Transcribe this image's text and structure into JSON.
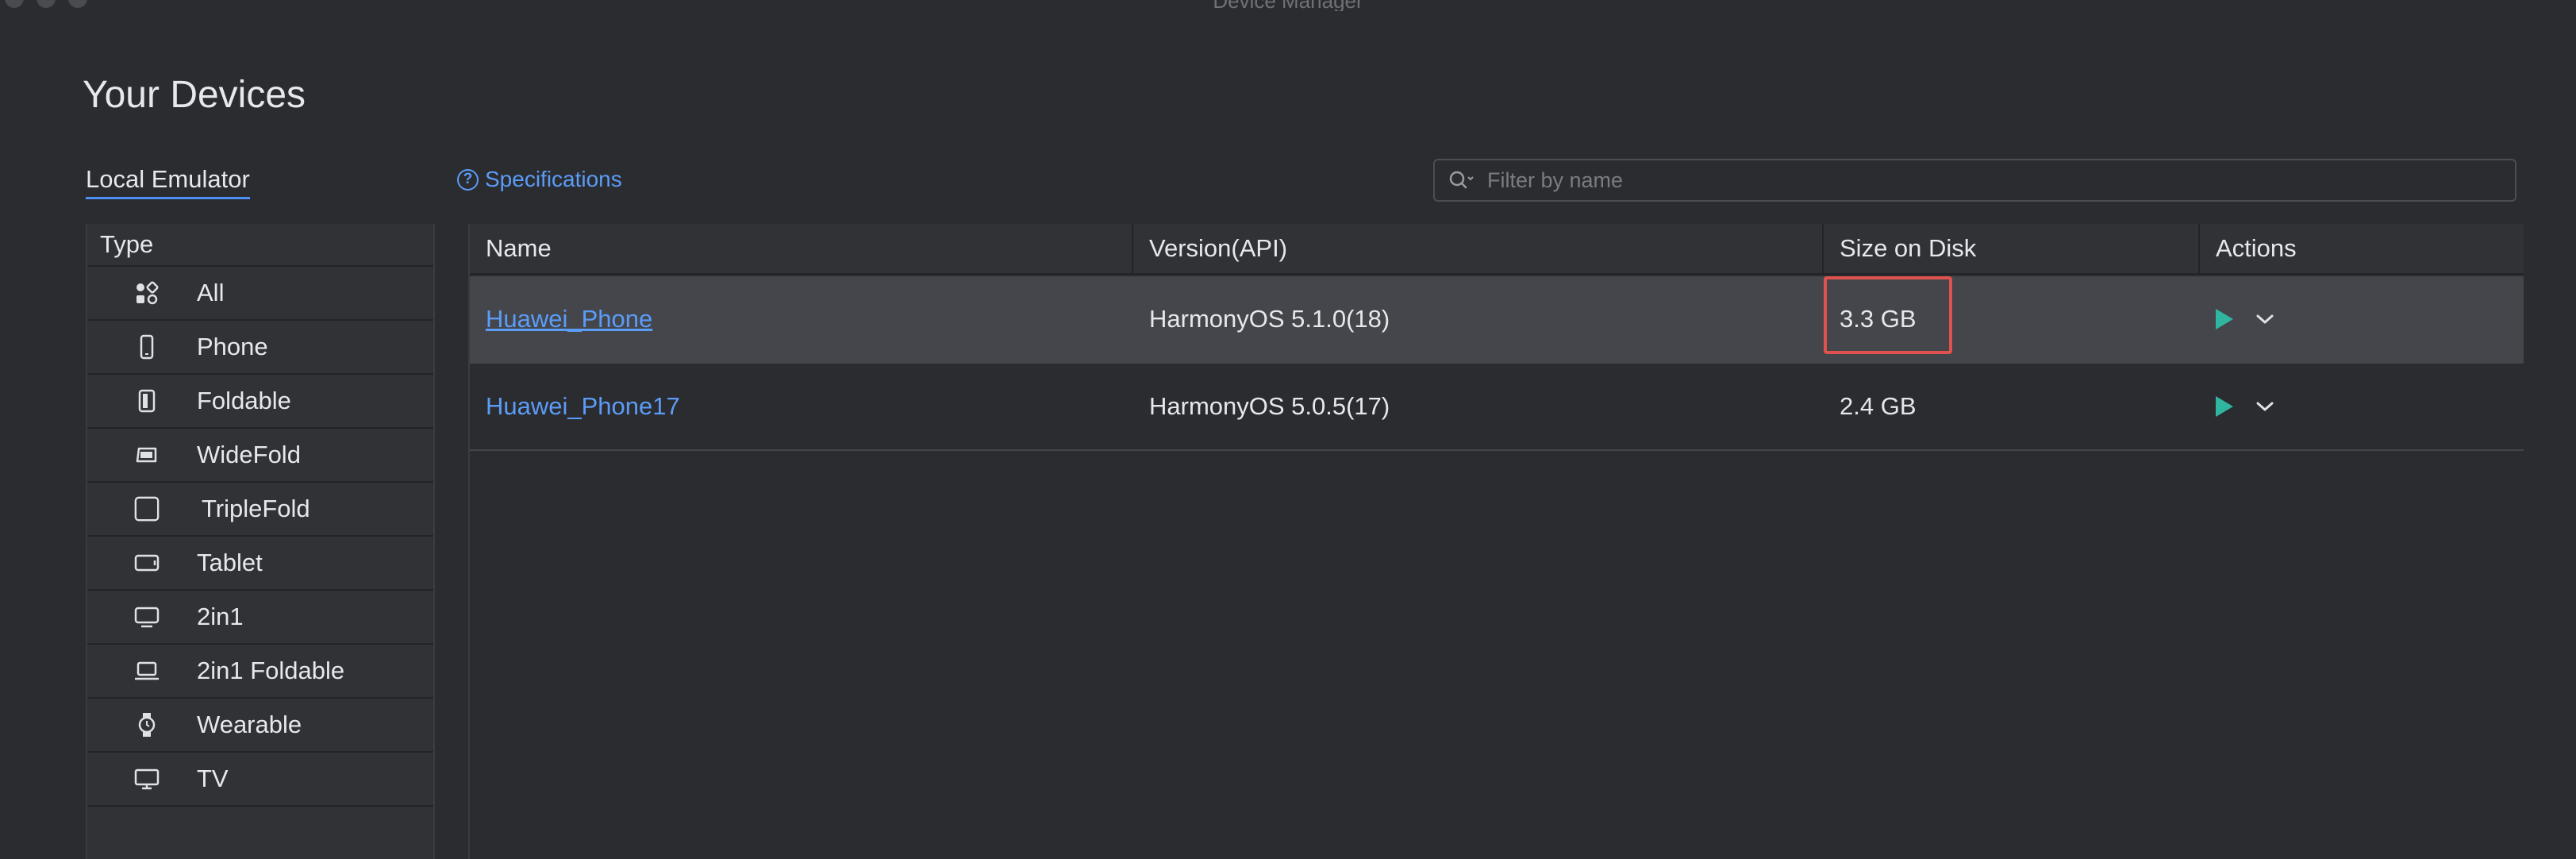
{
  "window": {
    "title": "Device Manager"
  },
  "page": {
    "title": "Your Devices"
  },
  "tabs": {
    "local_emulator": "Local Emulator"
  },
  "specifications": {
    "label": "Specifications",
    "icon": "help-circle-icon"
  },
  "filter": {
    "placeholder": "Filter by name",
    "value": "",
    "icon": "search-icon"
  },
  "sidebar": {
    "header": "Type",
    "items": [
      {
        "label": "All",
        "icon": "all-categories-icon"
      },
      {
        "label": "Phone",
        "icon": "phone-icon"
      },
      {
        "label": "Foldable",
        "icon": "foldable-icon"
      },
      {
        "label": "WideFold",
        "icon": "widefold-icon"
      },
      {
        "label": "TripleFold",
        "icon": "triplefold-icon"
      },
      {
        "label": "Tablet",
        "icon": "tablet-icon"
      },
      {
        "label": "2in1",
        "icon": "monitor-icon"
      },
      {
        "label": "2in1 Foldable",
        "icon": "laptop-icon"
      },
      {
        "label": "Wearable",
        "icon": "watch-icon"
      },
      {
        "label": "TV",
        "icon": "tv-icon"
      }
    ]
  },
  "table": {
    "columns": [
      "Name",
      "Version(API)",
      "Size on Disk",
      "Actions"
    ],
    "rows": [
      {
        "name": "Huawei_Phone",
        "version": "HarmonyOS 5.1.0(18)",
        "size": "3.3 GB",
        "selected": true
      },
      {
        "name": "Huawei_Phone17",
        "version": "HarmonyOS 5.0.5(17)",
        "size": "2.4 GB",
        "selected": false
      }
    ]
  },
  "colors": {
    "background": "#2b2c30",
    "accent_link": "#5b9cf7",
    "play_green": "#2fb5a0",
    "highlight_red": "#e0524d",
    "selected_row": "#45464b"
  }
}
